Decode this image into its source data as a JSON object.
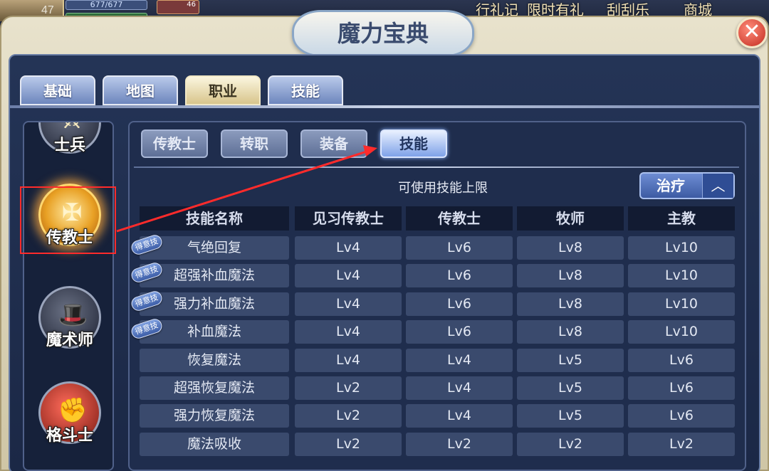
{
  "background": {
    "level": "47",
    "hp_text": "677/677",
    "pet_level": "46",
    "menu": [
      "行礼记",
      "限时有礼",
      "刮刮乐",
      "商城"
    ]
  },
  "window": {
    "title": "魔力宝典",
    "close_symbol": "✕"
  },
  "tabs": [
    {
      "label": "基础",
      "active": false
    },
    {
      "label": "地图",
      "active": false
    },
    {
      "label": "职业",
      "active": true
    },
    {
      "label": "技能",
      "active": false
    }
  ],
  "classes": [
    {
      "label": "士兵",
      "icon": "soldier-icon",
      "active": false
    },
    {
      "label": "传教士",
      "icon": "missionary-icon",
      "active": true
    },
    {
      "label": "魔术师",
      "icon": "magician-hat-icon",
      "active": false
    },
    {
      "label": "格斗士",
      "icon": "boxing-glove-icon",
      "active": false
    }
  ],
  "subtabs": [
    {
      "label": "传教士",
      "active": false
    },
    {
      "label": "转职",
      "active": false
    },
    {
      "label": "装备",
      "active": false
    },
    {
      "label": "技能",
      "active": true
    }
  ],
  "skill_limit": {
    "title": "可使用技能上限",
    "filter_value": "治疗",
    "filter_arrow": "︿"
  },
  "table": {
    "headers": [
      "技能名称",
      "见习传教士",
      "传教士",
      "牧师",
      "主教"
    ],
    "badge_text": "得意技",
    "rows": [
      {
        "name": "气绝回复",
        "fav": true,
        "levels": [
          "Lv4",
          "Lv6",
          "Lv8",
          "Lv10"
        ]
      },
      {
        "name": "超强补血魔法",
        "fav": true,
        "levels": [
          "Lv4",
          "Lv6",
          "Lv8",
          "Lv10"
        ]
      },
      {
        "name": "强力补血魔法",
        "fav": true,
        "levels": [
          "Lv4",
          "Lv6",
          "Lv8",
          "Lv10"
        ]
      },
      {
        "name": "补血魔法",
        "fav": true,
        "levels": [
          "Lv4",
          "Lv6",
          "Lv8",
          "Lv10"
        ]
      },
      {
        "name": "恢复魔法",
        "fav": false,
        "levels": [
          "Lv4",
          "Lv4",
          "Lv5",
          "Lv6"
        ]
      },
      {
        "name": "超强恢复魔法",
        "fav": false,
        "levels": [
          "Lv2",
          "Lv4",
          "Lv5",
          "Lv6"
        ]
      },
      {
        "name": "强力恢复魔法",
        "fav": false,
        "levels": [
          "Lv2",
          "Lv4",
          "Lv5",
          "Lv6"
        ]
      },
      {
        "name": "魔法吸收",
        "fav": false,
        "levels": [
          "Lv2",
          "Lv2",
          "Lv2",
          "Lv2"
        ]
      }
    ]
  },
  "colors": {
    "accent_active_tab": "#d8c58c",
    "panel_bg": "#1f2d4d",
    "annotation_red": "#ff2b2b"
  }
}
